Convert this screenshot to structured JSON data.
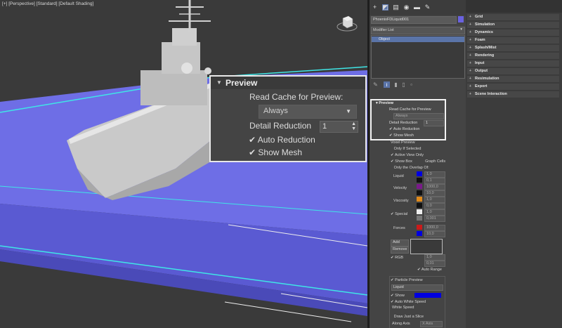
{
  "viewport": {
    "label": "[+] [Perspective] [Standard] [Default Shading]"
  },
  "callout": {
    "title": "Preview",
    "read_cache_label": "Read Cache for Preview:",
    "read_cache_value": "Always",
    "detail_reduction_label": "Detail Reduction",
    "detail_reduction_value": "1",
    "auto_reduction_label": "Auto Reduction",
    "show_mesh_label": "Show Mesh"
  },
  "panel": {
    "object_name": "PhoenixFDLiquid001",
    "object_color": "#6a62e0",
    "modifier_list": "Modifier List",
    "stack_item": "Object",
    "preview": {
      "title": "Preview",
      "read_cache_label": "Read Cache for Preview",
      "read_cache_value": "Always",
      "detail_reduction_label": "Detail Reduction",
      "detail_reduction_value": "1",
      "auto_reduction_label": "Auto Reduction",
      "show_mesh_label": "Show Mesh"
    },
    "voxel": {
      "title": "Voxel Preview",
      "only_if_selected": "Only If Selected",
      "active_view_only": "Active View Only",
      "show_box": "Show Box",
      "graph_cells": "Graph Cells",
      "only_overlap": "Only the Overlap Of:",
      "liquid": "Liquid",
      "velocity": "Velocity",
      "viscosity": "Viscosity",
      "special": "Special",
      "forces": "Forces",
      "values": [
        "1,0",
        "0,1",
        "1000,0",
        "10,0",
        "1,0",
        "0,0",
        "1,0",
        "0,001",
        "1000,0",
        "10,0"
      ],
      "add": "Add",
      "remove": "Remove",
      "rgb": "RGB",
      "rgb_values": [
        "1,0",
        "0,01"
      ],
      "auto_range": "Auto Range"
    },
    "particle": {
      "title": "Particle Preview",
      "dropdown": "Liquid",
      "show": "Show",
      "auto_white_speed": "Auto White Speed",
      "white_speed": "White Speed",
      "draw_slice": "Draw Just a Slice",
      "along_axis": "Along Axis",
      "along_axis_value": "X Axis"
    }
  },
  "rollouts": [
    "Grid",
    "Simulation",
    "Dynamics",
    "Foam",
    "Splash/Mist",
    "Rendering",
    "Input",
    "Output",
    "Resimulation",
    "Export",
    "Scene Interaction"
  ],
  "colors": {
    "water": "#6e6ee6",
    "viewport_bg": "#3a3a3a",
    "panel_bg": "#444444",
    "accent_blue": "#0000e0",
    "velocity": "#7a1a8a",
    "viscosity": "#e08a1a",
    "forces": "#cc1a1a"
  }
}
